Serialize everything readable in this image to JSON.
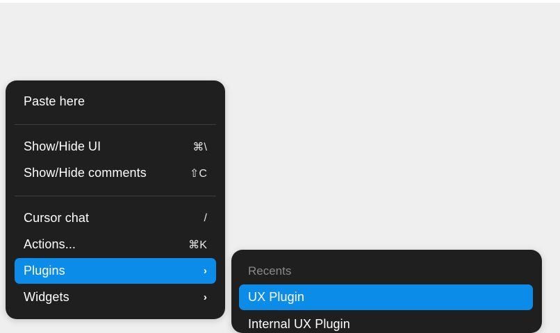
{
  "context_menu": {
    "items": [
      {
        "label": "Paste here",
        "shortcut": ""
      },
      {
        "label": "Show/Hide UI",
        "shortcut": "⌘\\"
      },
      {
        "label": "Show/Hide comments",
        "shortcut": "⇧C"
      },
      {
        "label": "Cursor chat",
        "shortcut": "/"
      },
      {
        "label": "Actions...",
        "shortcut": "⌘K"
      },
      {
        "label": "Plugins",
        "shortcut": "›"
      },
      {
        "label": "Widgets",
        "shortcut": "›"
      }
    ]
  },
  "plugins_submenu": {
    "section_label": "Recents",
    "items": [
      {
        "label": "UX Plugin"
      },
      {
        "label": "Internal UX Plugin"
      }
    ]
  },
  "colors": {
    "menu_background": "#1f1f1f",
    "highlight": "#0c8ce9",
    "canvas": "#efefef"
  }
}
